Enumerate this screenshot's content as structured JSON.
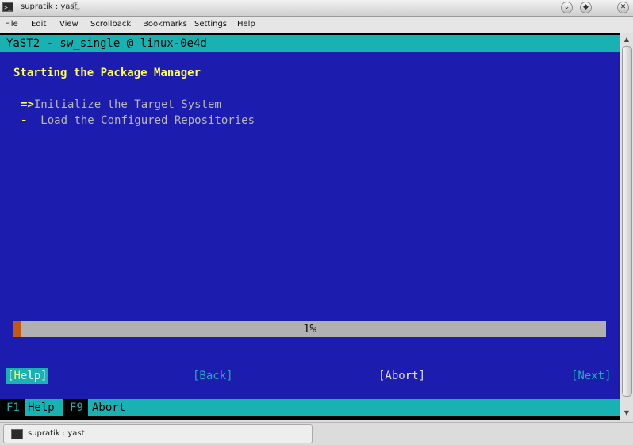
{
  "window": {
    "title": "supratik : yast",
    "controls": {
      "minimize": "⌄",
      "maximize": "◆",
      "close": "✕"
    }
  },
  "menu": {
    "items": [
      "File",
      "Edit",
      "View",
      "Scrollback",
      "Bookmarks",
      "Settings",
      "Help"
    ]
  },
  "terminal": {
    "header": "YaST2 - sw_single @ linux-0e4d",
    "heading": "Starting the Package Manager",
    "steps": [
      {
        "marker": "=>",
        "label": "Initialize the Target System"
      },
      {
        "marker": "-",
        "label": "  Load the Configured Repositories"
      }
    ],
    "progress": {
      "percent": 1,
      "label": "1%"
    },
    "buttons": {
      "help": {
        "open": "[",
        "hot": "H",
        "rest": "elp]"
      },
      "back": "[Back]",
      "abort": {
        "before": "[Abo",
        "hot": "r",
        "after": "t]"
      },
      "next": "[Next]"
    },
    "footer": [
      {
        "key": "F1",
        "label": "Help"
      },
      {
        "key": "F9",
        "label": "Abort"
      }
    ]
  },
  "taskbar": {
    "item": "supratik : yast"
  },
  "colors": {
    "terminal_bg": "#1c1cae",
    "accent_cyan": "#18b2b2",
    "highlight_yellow": "#ffff55",
    "progress_fill": "#c05a13"
  }
}
